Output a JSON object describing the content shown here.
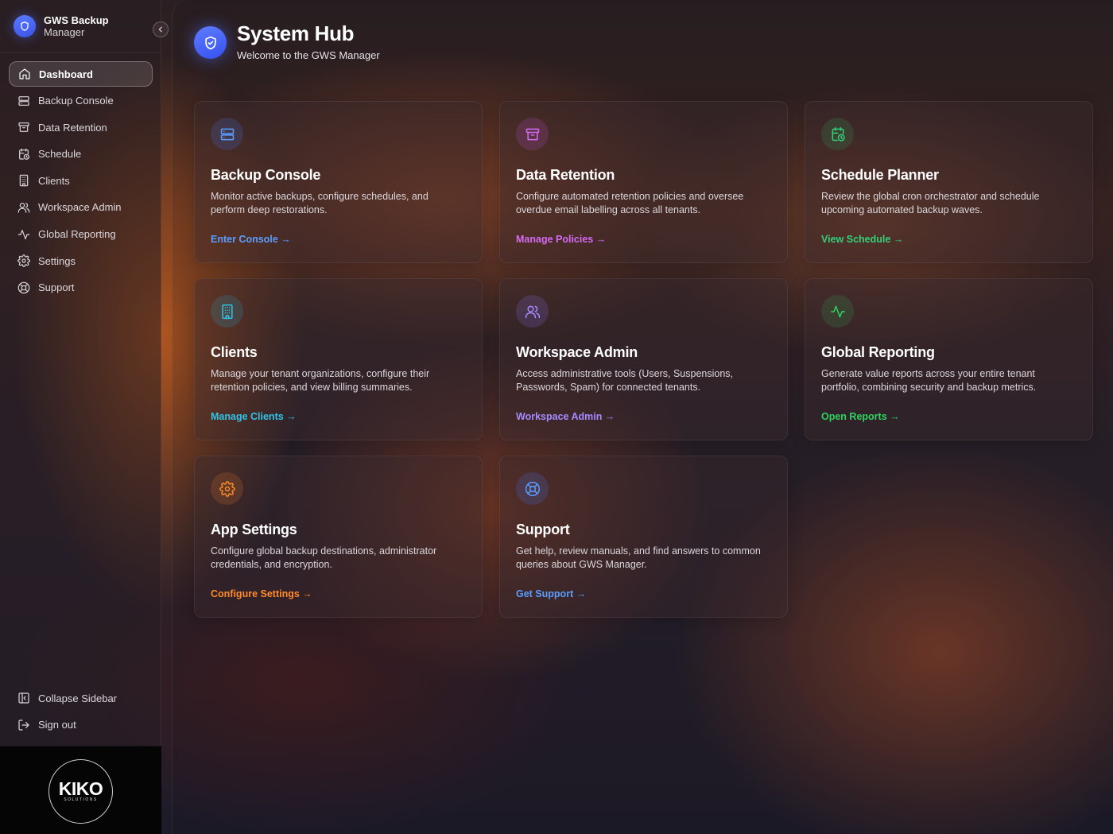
{
  "brand": {
    "title": "GWS Backup",
    "subtitle": "Manager"
  },
  "sidebar": {
    "items": [
      {
        "label": "Dashboard",
        "icon": "home-icon",
        "active": true
      },
      {
        "label": "Backup Console",
        "icon": "server-icon"
      },
      {
        "label": "Data Retention",
        "icon": "archive-icon"
      },
      {
        "label": "Schedule",
        "icon": "calendar-clock-icon"
      },
      {
        "label": "Clients",
        "icon": "building-icon"
      },
      {
        "label": "Workspace Admin",
        "icon": "users-icon"
      },
      {
        "label": "Global Reporting",
        "icon": "activity-icon"
      },
      {
        "label": "Settings",
        "icon": "gear-icon"
      },
      {
        "label": "Support",
        "icon": "lifebuoy-icon"
      }
    ],
    "bottom": [
      {
        "label": "Collapse Sidebar",
        "icon": "panel-left-icon"
      },
      {
        "label": "Sign out",
        "icon": "logout-icon"
      }
    ],
    "footer_logo": {
      "text": "KIKO",
      "sub": "SOLUTIONS"
    }
  },
  "header": {
    "title": "System Hub",
    "subtitle": "Welcome to the GWS Manager"
  },
  "cards": [
    {
      "title": "Backup Console",
      "desc": "Monitor active backups, configure schedules, and perform deep restorations.",
      "link": "Enter Console →",
      "icon": "server-icon",
      "accent": "#5b9dff"
    },
    {
      "title": "Data Retention",
      "desc": "Configure automated retention policies and oversee overdue email labelling across all tenants.",
      "link": "Manage Policies →",
      "icon": "archive-icon",
      "accent": "#d46bf2"
    },
    {
      "title": "Schedule Planner",
      "desc": "Review the global cron orchestrator and schedule upcoming automated backup waves.",
      "link": "View Schedule →",
      "icon": "calendar-clock-icon",
      "accent": "#34d07a"
    },
    {
      "title": "Clients",
      "desc": "Manage your tenant organizations, configure their retention policies, and view billing summaries.",
      "link": "Manage Clients →",
      "icon": "building-icon",
      "accent": "#2fc4e8"
    },
    {
      "title": "Workspace Admin",
      "desc": "Access administrative tools (Users, Suspensions, Passwords, Spam) for connected tenants.",
      "link": "Workspace Admin →",
      "icon": "users-icon",
      "accent": "#a58bff"
    },
    {
      "title": "Global Reporting",
      "desc": "Generate value reports across your entire tenant portfolio, combining security and backup metrics.",
      "link": "Open Reports →",
      "icon": "activity-icon",
      "accent": "#2fd35f"
    },
    {
      "title": "App Settings",
      "desc": "Configure global backup destinations, administrator credentials, and encryption.",
      "link": "Configure Settings →",
      "icon": "gear-icon",
      "accent": "#ff8a2a"
    },
    {
      "title": "Support",
      "desc": "Get help, review manuals, and find answers to common queries about GWS Manager.",
      "link": "Get Support →",
      "icon": "lifebuoy-icon",
      "accent": "#5b9dff"
    }
  ]
}
